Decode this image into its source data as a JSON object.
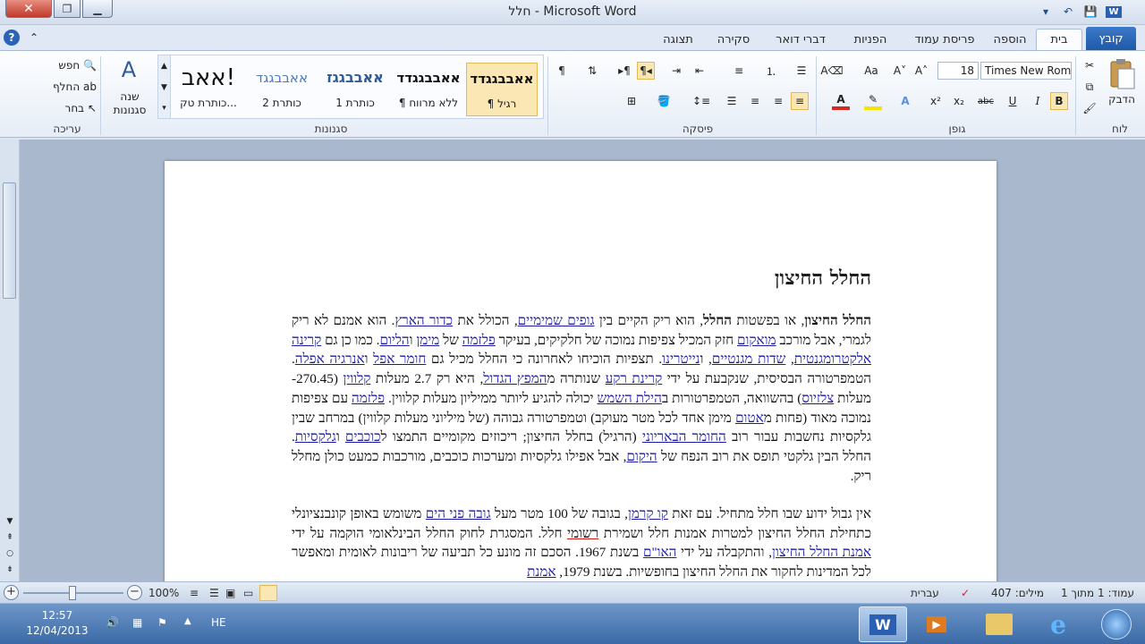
{
  "window": {
    "title": "חלל - Microsoft Word"
  },
  "tabs": [
    "קובץ",
    "בית",
    "הוספה",
    "פריסת עמוד",
    "הפניות",
    "דברי דואר",
    "סקירה",
    "תצוגה"
  ],
  "ribbon": {
    "clipboard": {
      "label": "לוח",
      "paste_label": "הדבק"
    },
    "font": {
      "label": "גופן",
      "font_name": "Times New Roman",
      "font_size": "18"
    },
    "paragraph": {
      "label": "פיסקה"
    },
    "styles": {
      "label": "סגנונות",
      "items": [
        {
          "sample": "אאבבגגדד",
          "name": "¶ רגיל"
        },
        {
          "sample": "אאבבגגדד",
          "name": "¶ ללא מרווח"
        },
        {
          "sample": "אאבבגגז",
          "name": "כותרת 1"
        },
        {
          "sample": "אאבבגגד",
          "name": "כותרת 2"
        },
        {
          "sample": "אאב!",
          "name": "כותרת טק..."
        }
      ],
      "change_styles_label": "שנה סגנונות"
    },
    "editing": {
      "label": "עריכה",
      "find": "חפש",
      "replace": "החלף",
      "select": "בחר"
    }
  },
  "document": {
    "heading": "החלל החיצון",
    "para1_parts": [
      {
        "t": "החלל החיצון",
        "b": true
      },
      {
        "t": ", או בפשטות "
      },
      {
        "t": "החלל",
        "b": true
      },
      {
        "t": ", הוא ריק הקיים בין "
      },
      {
        "t": "גופים שמימיים",
        "l": true
      },
      {
        "t": ", הכולל את "
      },
      {
        "t": "כדור הארץ",
        "l": true
      },
      {
        "t": ". הוא אמנם לא ריק לגמרי, אבל מורכב "
      },
      {
        "t": "מואקום",
        "l": true
      },
      {
        "t": " חזק המכיל צפיפות נמוכה של חלקיקים, בעיקר "
      },
      {
        "t": "פלזמה",
        "l": true
      },
      {
        "t": " של "
      },
      {
        "t": "מימן",
        "l": true
      },
      {
        "t": " ו"
      },
      {
        "t": "הליום",
        "l": true
      },
      {
        "t": ". כמו כן גם "
      },
      {
        "t": "קרינה אלקטרומגנטית",
        "l": true
      },
      {
        "t": ", "
      },
      {
        "t": "שדות מגנטיים",
        "l": true
      },
      {
        "t": ", ו"
      },
      {
        "t": "נייטרינו",
        "l": true
      },
      {
        "t": ". תצפיות הוכיחו לאחרונה כי החלל מכיל גם "
      },
      {
        "t": "חומר אפל",
        "l": true
      },
      {
        "t": " ו"
      },
      {
        "t": "אנרגיה אפלה",
        "l": true
      },
      {
        "t": ". הטמפרטורה הבסיסית, שנקבעת על ידי "
      },
      {
        "t": "קרינת רקע",
        "l": true
      },
      {
        "t": " שנותרה מ"
      },
      {
        "t": "המפץ הגדול",
        "l": true
      },
      {
        "t": ", היא רק 2.7 מעלות "
      },
      {
        "t": "קלווין",
        "l": true
      },
      {
        "t": " (270.45- מעלות "
      },
      {
        "t": "צלזיוס",
        "l": true
      },
      {
        "t": ") בהשוואה, הטמפרטורות ב"
      },
      {
        "t": "הילת השמש",
        "l": true
      },
      {
        "t": " יכולה להגיע ליותר ממיליון מעלות קלווין. "
      },
      {
        "t": "פלזמה",
        "l": true
      },
      {
        "t": " עם צפיפות נמוכה מאוד (פחות מ"
      },
      {
        "t": "אטום",
        "l": true
      },
      {
        "t": " מימן אחד לכל מטר מעוקב) וטמפרטורה גבוהה (של מיליוני מעלות קלווין) במרחב שבין גלקסיות נחשבות עבור רוב "
      },
      {
        "t": "החומר הבאריוני",
        "l": true
      },
      {
        "t": " (הרגיל) בחלל החיצון; ריכוזים מקומיים התמצו ל"
      },
      {
        "t": "כוכבים",
        "l": true
      },
      {
        "t": " ו"
      },
      {
        "t": "גלקסיות",
        "l": true
      },
      {
        "t": ". החלל הבין גלקטי תופס את רוב הנפח של "
      },
      {
        "t": "היקום",
        "l": true
      },
      {
        "t": ", אבל אפילו גלקסיות ומערכות כוכבים, מורכבות כמעט כולן מחלל ריק."
      }
    ],
    "para2_parts": [
      {
        "t": "אין גבול ידוע שבו חלל מתחיל. עם זאת "
      },
      {
        "t": "קו קרמן",
        "l": true
      },
      {
        "t": ", בגובה של 100 מטר מעל "
      },
      {
        "t": "גובה פני הים",
        "l": true
      },
      {
        "t": " משומש באופן קונבנציונלי כתחילת החלל החיצון למטרות אמנות חלל ושמירת "
      },
      {
        "t": "רשומי",
        "u": true
      },
      {
        "t": " חלל. המסגרת לחוק החלל הבינלאומי הוקמה על ידי "
      },
      {
        "t": "אמנת החלל החיצון",
        "l": true
      },
      {
        "t": ", והתקבלה על ידי "
      },
      {
        "t": "האו\"ם",
        "l": true
      },
      {
        "t": " בשנת 1967. הסכם זה מונע כל תביעה של ריבונות לאומית ומאפשר לכל המדינות לחקור את החלל החיצון בחופשיות. בשנת 1979, "
      },
      {
        "t": "אמנת",
        "l": true
      }
    ]
  },
  "status": {
    "page": "עמוד: 1 מתוך 1",
    "words": "מילים: 407",
    "language": "עברית",
    "zoom": "100%",
    "zoom_level": 1.0
  },
  "taskbar": {
    "language": "HE",
    "time": "12:57",
    "date": "12/04/2013"
  },
  "colors": {
    "link": "#1a1aa6",
    "accent": "#2b63b5"
  }
}
